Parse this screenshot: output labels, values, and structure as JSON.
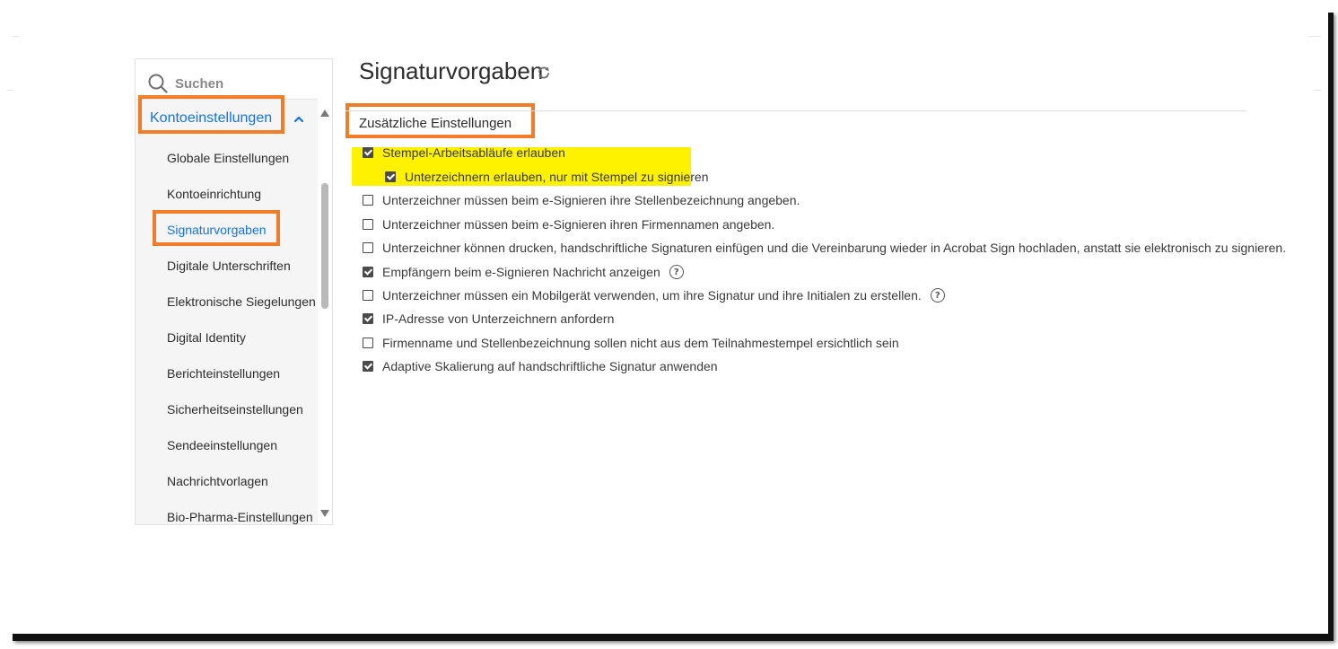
{
  "sidebar": {
    "search_placeholder": "Suchen",
    "section_label": "Kontoeinstellungen",
    "items": [
      {
        "label": "Globale Einstellungen",
        "active": false
      },
      {
        "label": "Kontoeinrichtung",
        "active": false
      },
      {
        "label": "Signaturvorgaben",
        "active": true
      },
      {
        "label": "Digitale Unterschriften",
        "active": false
      },
      {
        "label": "Elektronische Siegelungen",
        "active": false
      },
      {
        "label": "Digital Identity",
        "active": false
      },
      {
        "label": "Berichteinstellungen",
        "active": false
      },
      {
        "label": "Sicherheitseinstellungen",
        "active": false
      },
      {
        "label": "Sendeeinstellungen",
        "active": false
      },
      {
        "label": "Nachrichtvorlagen",
        "active": false
      },
      {
        "label": "Bio-Pharma-Einstellungen",
        "active": false
      }
    ]
  },
  "main": {
    "title": "Signaturvorgaben",
    "section_title": "Zusätzliche Einstellungen",
    "options": [
      {
        "label": "Stempel-Arbeitsabläufe erlauben",
        "checked": true
      },
      {
        "label": "Unterzeichnern erlauben, nur mit Stempel zu signieren",
        "checked": true
      },
      {
        "label": "Unterzeichner müssen beim e-Signieren ihre Stellenbezeichnung angeben.",
        "checked": false
      },
      {
        "label": "Unterzeichner müssen beim e-Signieren ihren Firmennamen angeben.",
        "checked": false
      },
      {
        "label": "Unterzeichner können drucken, handschriftliche Signaturen einfügen und die Vereinbarung wieder in Acrobat Sign hochladen, anstatt sie elektronisch zu signieren.",
        "checked": false
      },
      {
        "label": "Empfängern beim e-Signieren Nachricht anzeigen",
        "checked": true
      },
      {
        "label": "Unterzeichner müssen ein Mobilgerät verwenden, um ihre Signatur und ihre Initialen zu erstellen.",
        "checked": false
      },
      {
        "label": "IP-Adresse von Unterzeichnern anfordern",
        "checked": true
      },
      {
        "label": "Firmenname und Stellenbezeichnung sollen nicht aus dem Teilnahmestempel ersichtlich sein",
        "checked": false
      },
      {
        "label": "Adaptive Skalierung auf handschriftliche Signatur anwenden",
        "checked": true
      }
    ],
    "help_glyph": "?"
  },
  "colors": {
    "accent": "#1473e6",
    "annotation_orange": "#f07d29",
    "highlight_yellow": "#fff200"
  }
}
